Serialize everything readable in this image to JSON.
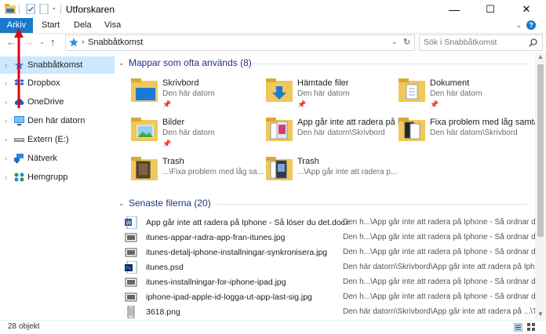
{
  "window": {
    "title": "Utforskaren",
    "minimize": "—",
    "maximize": "☐",
    "close": "✕"
  },
  "ribbon": {
    "tabs": [
      "Arkiv",
      "Start",
      "Dela",
      "Visa"
    ],
    "help": "?"
  },
  "nav": {
    "back": "←",
    "forward": "→",
    "dropdown": "⌄",
    "up": "↑"
  },
  "address": {
    "path": "Snabbåtkomst",
    "separator": "›",
    "refresh": "↻"
  },
  "search": {
    "placeholder": "Sök i Snabbåtkomst"
  },
  "sidebar": {
    "items": [
      {
        "label": "Snabbåtkomst",
        "icon": "star-icon"
      },
      {
        "label": "Dropbox",
        "icon": "dropbox-icon"
      },
      {
        "label": "OneDrive",
        "icon": "cloud-icon"
      },
      {
        "label": "Den här datorn",
        "icon": "computer-icon"
      },
      {
        "label": "Extern (E:)",
        "icon": "drive-icon"
      },
      {
        "label": "Nätverk",
        "icon": "network-icon"
      },
      {
        "label": "Hemgrupp",
        "icon": "homegroup-icon"
      }
    ]
  },
  "frequent": {
    "header": "Mappar som ofta används (8)",
    "items": [
      {
        "name": "Skrivbord",
        "location": "Den här datorn",
        "pinned": true
      },
      {
        "name": "Hämtade filer",
        "location": "Den här datorn",
        "pinned": true
      },
      {
        "name": "Dokument",
        "location": "Den här datorn",
        "pinned": true
      },
      {
        "name": "Bilder",
        "location": "Den här datorn",
        "pinned": true
      },
      {
        "name": "App går inte att radera på Ip...",
        "location": "Den här datorn\\Skrivbord",
        "pinned": false
      },
      {
        "name": "Fixa problem med låg samtal...",
        "location": "Den här datorn\\Skrivbord",
        "pinned": false
      },
      {
        "name": "Trash",
        "location": "...\\Fixa problem med låg sa...",
        "pinned": false
      },
      {
        "name": "Trash",
        "location": "...\\App går inte att radera p...",
        "pinned": false
      }
    ]
  },
  "recent": {
    "header": "Senaste filerna (20)",
    "items": [
      {
        "name": "App går inte att radera på Iphone - Så löser du det.docx",
        "path": "Den h...\\App går inte att radera på Iphone - Så ordnar du det",
        "type": "docx"
      },
      {
        "name": "itunes-appar-radra-app-fran-itunes.jpg",
        "path": "Den h...\\App går inte att radera på Iphone - Så ordnar du det",
        "type": "jpg"
      },
      {
        "name": "itunes-detalj-iphone-installningar-synkronisera.jpg",
        "path": "Den h...\\App går inte att radera på Iphone - Så ordnar du det",
        "type": "jpg"
      },
      {
        "name": "itunes.psd",
        "path": "Den här datorn\\Skrivbord\\App går inte att radera på Iphone",
        "type": "psd"
      },
      {
        "name": "itunes-installningar-for-iphone-ipad.jpg",
        "path": "Den h...\\App går inte att radera på Iphone - Så ordnar du det",
        "type": "jpg"
      },
      {
        "name": "iphone-ipad-apple-id-logga-ut-app-last-sig.jpg",
        "path": "Den h...\\App går inte att radera på Iphone - Så ordnar du det",
        "type": "jpg"
      },
      {
        "name": "3618.png",
        "path": "Den här datorn\\Skrivbord\\App går inte att radera på ...\\Trash",
        "type": "png"
      }
    ]
  },
  "status": {
    "text": "28 objekt"
  },
  "colors": {
    "accent": "#1979ca",
    "folder": "#f0c75a",
    "annotation": "#e0001a"
  }
}
